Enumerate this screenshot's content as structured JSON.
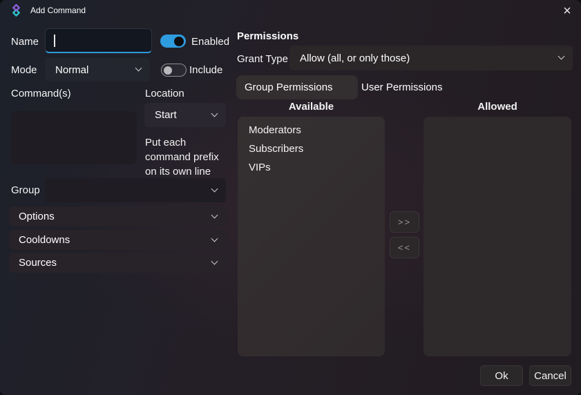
{
  "titlebar": {
    "title": "Add Command",
    "close_glyph": "×"
  },
  "left": {
    "name_label": "Name",
    "name_value": "",
    "enabled_label": "Enabled",
    "mode_label": "Mode",
    "mode_value": "Normal",
    "include_label": "Include",
    "commands_label": "Command(s)",
    "commands_value": "",
    "location_label": "Location",
    "location_value": "Start",
    "location_hint": "Put each command prefix on its own line",
    "group_label": "Group",
    "group_value": "",
    "expanders": [
      {
        "label": "Options"
      },
      {
        "label": "Cooldowns"
      },
      {
        "label": "Sources"
      }
    ]
  },
  "permissions": {
    "header": "Permissions",
    "grant_type_label": "Grant Type",
    "grant_type_value": "Allow (all, or only those)",
    "tabs": [
      {
        "label": "Group Permissions",
        "selected": true
      },
      {
        "label": "User Permissions",
        "selected": false
      }
    ],
    "available_header": "Available",
    "allowed_header": "Allowed",
    "available_items": [
      "Moderators",
      "Subscribers",
      "VIPs"
    ],
    "allowed_items": [],
    "move_right_label": ">>",
    "move_left_label": "<<"
  },
  "footer": {
    "ok_label": "Ok",
    "cancel_label": "Cancel"
  },
  "toggles": {
    "enabled_state": "on",
    "include_state": "off"
  },
  "colors": {
    "accent": "#2e9cdf",
    "logo_purple": "#8b5fd7",
    "logo_teal": "#2bc3c9"
  }
}
